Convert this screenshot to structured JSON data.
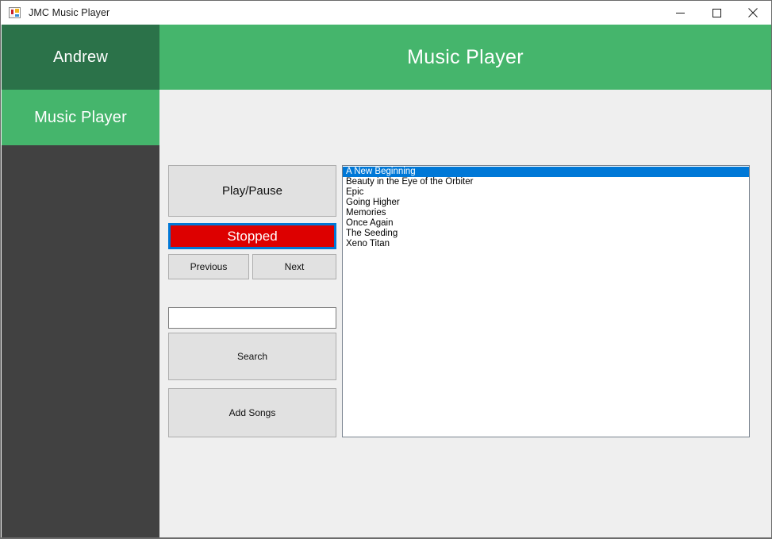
{
  "window": {
    "title": "JMC Music Player",
    "icon": "winforms-app-icon",
    "controls": {
      "minimize": "minimize-icon",
      "maximize": "maximize-icon",
      "close": "close-icon"
    }
  },
  "sidebar": {
    "username": "Andrew",
    "items": [
      {
        "label": "Music Player",
        "active": true
      }
    ]
  },
  "header": {
    "title": "Music Player"
  },
  "controls": {
    "play_pause_label": "Play/Pause",
    "status_label": "Stopped",
    "previous_label": "Previous",
    "next_label": "Next",
    "search_label": "Search",
    "add_songs_label": "Add Songs"
  },
  "search": {
    "value": "",
    "placeholder": ""
  },
  "song_list": {
    "selected_index": 0,
    "items": [
      "A New Beginning",
      "Beauty in the Eye of the Orbiter",
      "Epic",
      "Going Higher",
      "Memories",
      "Once Again",
      "The Seeding",
      "Xeno Titan"
    ]
  },
  "colors": {
    "brand_green": "#45b56c",
    "brand_green_dark": "#2b7249",
    "sidebar_dark": "#414141",
    "status_red": "#dd0000",
    "focus_blue": "#0078d7",
    "surface": "#efefef"
  }
}
